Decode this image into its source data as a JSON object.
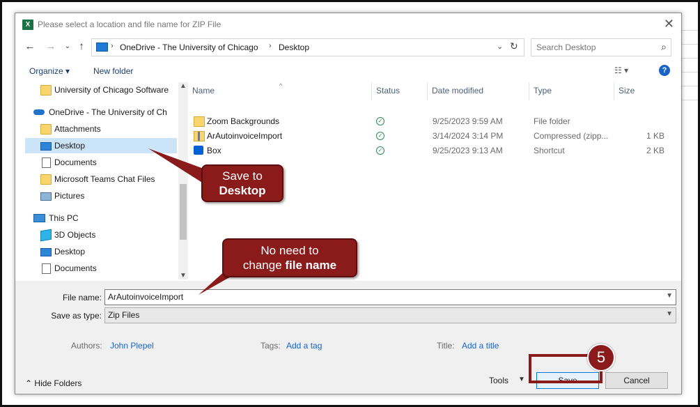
{
  "dialog": {
    "title": "Please select a location and file name for ZIP File",
    "app_icon": "X",
    "close_glyph": "✕"
  },
  "address": {
    "crumbs": [
      "OneDrive - The University of Chicago",
      "Desktop"
    ],
    "search_placeholder": "Search Desktop"
  },
  "toolbar": {
    "organize_label": "Organize ▾",
    "new_folder_label": "New folder",
    "help_glyph": "?"
  },
  "nav": {
    "items": [
      {
        "label": "University of Chicago Software",
        "icon": "folder-icon"
      },
      {
        "label": "OneDrive - The University of Ch",
        "icon": "onedrive-icon"
      },
      {
        "label": "Attachments",
        "icon": "folder-icon"
      },
      {
        "label": "Desktop",
        "icon": "desktop-icon"
      },
      {
        "label": "Documents",
        "icon": "documents-icon"
      },
      {
        "label": "Microsoft Teams Chat Files",
        "icon": "folder-icon"
      },
      {
        "label": "Pictures",
        "icon": "pictures-icon"
      },
      {
        "label": "This PC",
        "icon": "this-pc-icon"
      },
      {
        "label": "3D Objects",
        "icon": "3d-objects-icon"
      },
      {
        "label": "Desktop",
        "icon": "desktop-icon"
      },
      {
        "label": "Documents",
        "icon": "documents-icon"
      }
    ]
  },
  "files": {
    "columns": [
      "Name",
      "Status",
      "Date modified",
      "Type",
      "Size"
    ],
    "rows": [
      {
        "name": "Zoom Backgrounds",
        "date": "9/25/2023 9:59 AM",
        "type": "File folder",
        "size": "",
        "icon": "folder-icon"
      },
      {
        "name": "ArAutoinvoiceImport",
        "date": "3/14/2024 3:14 PM",
        "type": "Compressed (zipp...",
        "size": "1 KB",
        "icon": "zip-folder-icon"
      },
      {
        "name": "Box",
        "date": "9/25/2023 9:13 AM",
        "type": "Shortcut",
        "size": "2 KB",
        "icon": "box-icon"
      }
    ]
  },
  "form": {
    "file_name_label": "File name:",
    "file_name_value": "ArAutoinvoiceImport",
    "save_type_label": "Save as type:",
    "save_type_value": "Zip Files",
    "authors_label": "Authors:",
    "authors_value": "John Plepel",
    "tags_label": "Tags:",
    "tags_value": "Add a tag",
    "title_label": "Title:",
    "title_value": "Add a title"
  },
  "footer": {
    "hide_folders_label": "Hide Folders",
    "tools_label": "Tools",
    "save_label": "Save",
    "cancel_label": "Cancel"
  },
  "annotations": {
    "callout_desktop_line1": "Save to",
    "callout_desktop_line2": "Desktop",
    "callout_name_line1": "No need to",
    "callout_name_line2_a": "change ",
    "callout_name_line2_b": "file name",
    "step_number": "5",
    "accent_color": "#8b1a1a"
  }
}
